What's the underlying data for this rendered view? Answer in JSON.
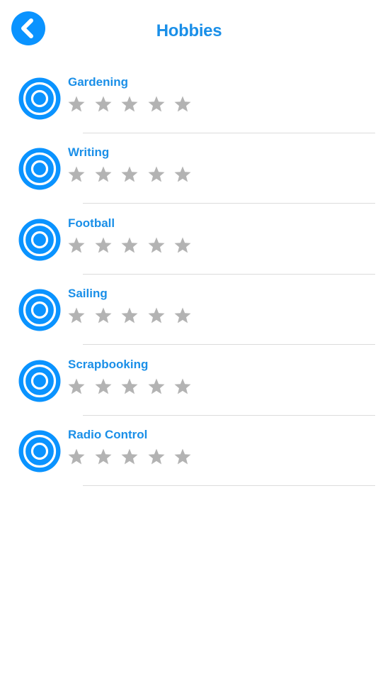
{
  "header": {
    "title": "Hobbies",
    "back_icon": "chevron-left-icon"
  },
  "colors": {
    "accent": "#0a93ff",
    "title_text": "#1a8fe8",
    "star_empty": "#b3b3b3",
    "divider": "#dcdcdc"
  },
  "hobbies": [
    {
      "label": "Gardening",
      "rating": 0,
      "max_rating": 5,
      "icon": "target-icon"
    },
    {
      "label": "Writing",
      "rating": 0,
      "max_rating": 5,
      "icon": "target-icon"
    },
    {
      "label": "Football",
      "rating": 0,
      "max_rating": 5,
      "icon": "target-icon"
    },
    {
      "label": "Sailing",
      "rating": 0,
      "max_rating": 5,
      "icon": "target-icon"
    },
    {
      "label": "Scrapbooking",
      "rating": 0,
      "max_rating": 5,
      "icon": "target-icon"
    },
    {
      "label": "Radio Control",
      "rating": 0,
      "max_rating": 5,
      "icon": "target-icon"
    }
  ]
}
